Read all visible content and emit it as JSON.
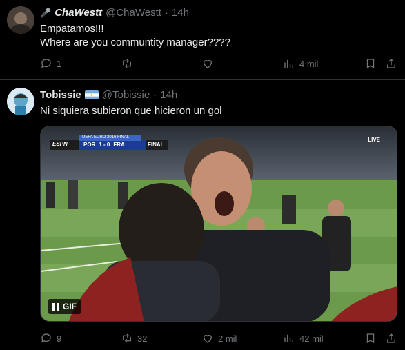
{
  "tweets": [
    {
      "display_name": "ChaWestt",
      "handle": "@ChaWestt",
      "time": "14h",
      "text_lines": [
        "Empatamos!!!",
        "Where are you communtity manager????"
      ],
      "reply_count": "1",
      "retweet_count": "",
      "like_count": "",
      "views": "4 mil"
    },
    {
      "display_name": "Tobissie",
      "handle": "@Tobissie",
      "time": "14h",
      "text_lines": [
        "Ni siquiera subieron que hicieron un gol"
      ],
      "media": {
        "badge": "GIF",
        "scoreboard_brand": "ESPN",
        "scoreboard_event": "UEFA EURO 2016 FINAL",
        "team1": "POR",
        "score": "1 - 0",
        "team2": "FRA",
        "stage": "FINAL",
        "live": "LIVE"
      },
      "reply_count": "9",
      "retweet_count": "32",
      "like_count": "2 mil",
      "views": "42 mil"
    }
  ],
  "dot": "·"
}
